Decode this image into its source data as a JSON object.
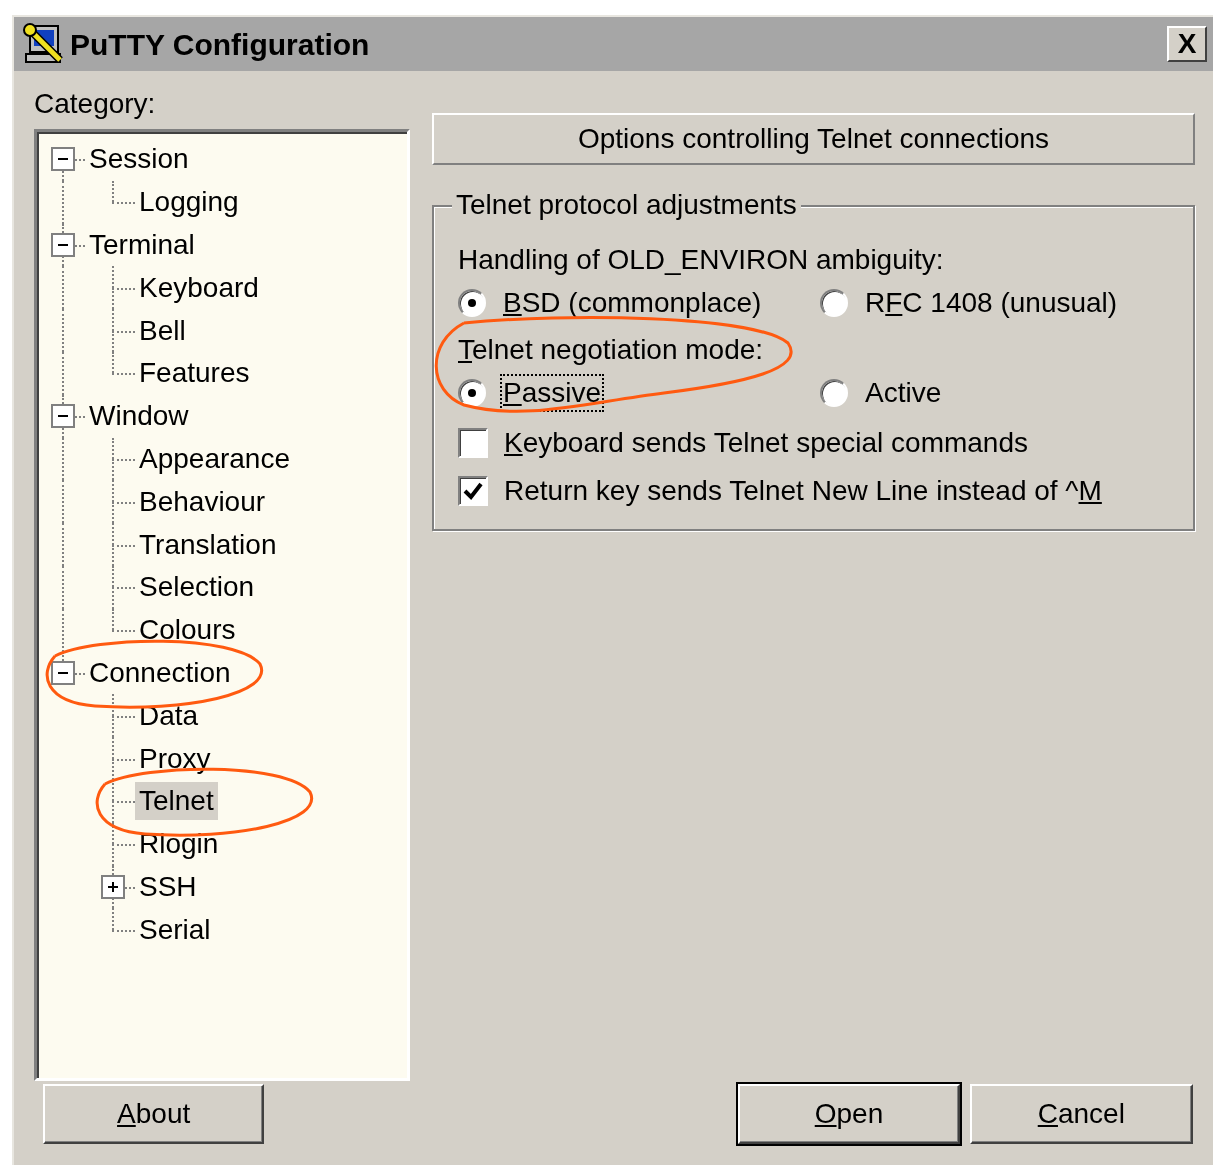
{
  "window": {
    "title": "PuTTY Configuration",
    "close_label": "X"
  },
  "category_label": "Category:",
  "tree": [
    {
      "label": "Session",
      "expanded": true,
      "selected": false,
      "children": [
        {
          "label": "Logging",
          "selected": false
        }
      ]
    },
    {
      "label": "Terminal",
      "expanded": true,
      "selected": false,
      "children": [
        {
          "label": "Keyboard",
          "selected": false
        },
        {
          "label": "Bell",
          "selected": false
        },
        {
          "label": "Features",
          "selected": false
        }
      ]
    },
    {
      "label": "Window",
      "expanded": true,
      "selected": false,
      "children": [
        {
          "label": "Appearance",
          "selected": false
        },
        {
          "label": "Behaviour",
          "selected": false
        },
        {
          "label": "Translation",
          "selected": false
        },
        {
          "label": "Selection",
          "selected": false
        },
        {
          "label": "Colours",
          "selected": false
        }
      ]
    },
    {
      "label": "Connection",
      "expanded": true,
      "selected": false,
      "circled": true,
      "children": [
        {
          "label": "Data",
          "selected": false
        },
        {
          "label": "Proxy",
          "selected": false
        },
        {
          "label": "Telnet",
          "selected": true,
          "circled": true
        },
        {
          "label": "Rlogin",
          "selected": false
        },
        {
          "label": "SSH",
          "expanded": false,
          "selected": false
        },
        {
          "label": "Serial",
          "selected": false
        }
      ]
    }
  ],
  "panel_header": "Options controlling Telnet connections",
  "group": {
    "title": "Telnet protocol adjustments",
    "controls": [
      {
        "kind": "radio",
        "label": {
          "pre": "Handling of OLD_ENVIRON ambiguity:"
        },
        "options": [
          {
            "label": {
              "key": "B",
              "post": "SD (commonplace)"
            },
            "selected": true
          },
          {
            "label": {
              "pre": "R",
              "key": "F",
              "post": "C 1408 (unusual)"
            },
            "selected": false
          }
        ]
      },
      {
        "kind": "radio",
        "label": {
          "key": "T",
          "post": "elnet negotiation mode:"
        },
        "circled": true,
        "options": [
          {
            "label": {
              "key": "P",
              "post": "assive"
            },
            "selected": true,
            "focused": true
          },
          {
            "label": {
              "pre": "Active"
            },
            "selected": false
          }
        ]
      },
      {
        "kind": "checkbox",
        "label": {
          "key": "K",
          "post": "eyboard sends Telnet special commands"
        },
        "checked": false
      },
      {
        "kind": "checkbox",
        "label": {
          "pre": "Return key sends Telnet New Line instead of ^",
          "key": "M"
        },
        "checked": true
      }
    ]
  },
  "buttons": [
    {
      "label": {
        "key": "A",
        "post": "bout"
      },
      "default": false
    },
    {
      "label": {
        "key": "O",
        "post": "pen"
      },
      "default": true
    },
    {
      "label": {
        "key": "C",
        "post": "ancel"
      },
      "default": false
    }
  ]
}
